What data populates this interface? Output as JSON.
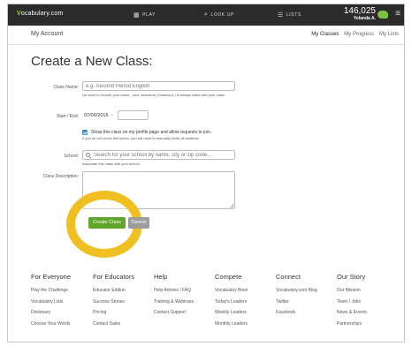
{
  "topnav": {
    "logo_prefix": "V",
    "logo_rest": "ocabulary.com",
    "play_label": "PLAY",
    "play_icon": "grid-icon",
    "lookup_label": "LOOK UP",
    "lookup_icon": "search-icon",
    "lists_label": "LISTS",
    "lists_icon": "list-icon",
    "points": "146,025",
    "username": "Yolanda A.",
    "badge_color": "#7ec13f",
    "menu_icon": "hamburger-icon"
  },
  "subnav": {
    "title": "My Account",
    "links": [
      "My Classes",
      "My Progress",
      "My Lists"
    ]
  },
  "page": {
    "title": "Create a New Class:"
  },
  "form": {
    "class_name_label": "Class Name:",
    "class_name_placeholder": "e.g. Second Period English",
    "class_name_hint": "No need to include your name - your nickname (Yolanda A.) is always listed with your class.",
    "start_end_label": "Start / End:",
    "start_date": "07/06/2016",
    "date_separator": "-",
    "end_date": "",
    "show_checkbox_checked": true,
    "show_checkbox_label": "Show this class on my profile page and allow requests to join.",
    "show_checkbox_hint": "If you do not check this option, you will need to manually invite all students.",
    "school_label": "School:",
    "school_placeholder": "Search for your school by name, city or zip code...",
    "school_hint": "Associate this class with your school",
    "description_label": "Class Description:",
    "create_button": "Create Class",
    "cancel_button": "Cancel",
    "accent_color": "#5fa52b",
    "highlight_color": "#f0bf22"
  },
  "footer": {
    "columns": [
      {
        "heading": "For Everyone",
        "links": [
          "Play the Challenge",
          "Vocabulary Lists",
          "Dictionary",
          "Choose Your Words"
        ]
      },
      {
        "heading": "For Educators",
        "links": [
          "Educator Edition",
          "Success Stories",
          "Pricing",
          "Contact Sales"
        ]
      },
      {
        "heading": "Help",
        "links": [
          "Help Articles / FAQ",
          "Training & Webinars",
          "Contact Support"
        ]
      },
      {
        "heading": "Compete",
        "links": [
          "Vocabulary Bowl",
          "Today's Leaders",
          "Weekly Leaders",
          "Monthly Leaders"
        ]
      },
      {
        "heading": "Connect",
        "links": [
          "Vocabulary.com Blog",
          "Twitter",
          "Facebook"
        ]
      },
      {
        "heading": "Our Story",
        "links": [
          "Our Mission",
          "Team / Jobs",
          "News & Events",
          "Partnerships"
        ]
      }
    ]
  }
}
